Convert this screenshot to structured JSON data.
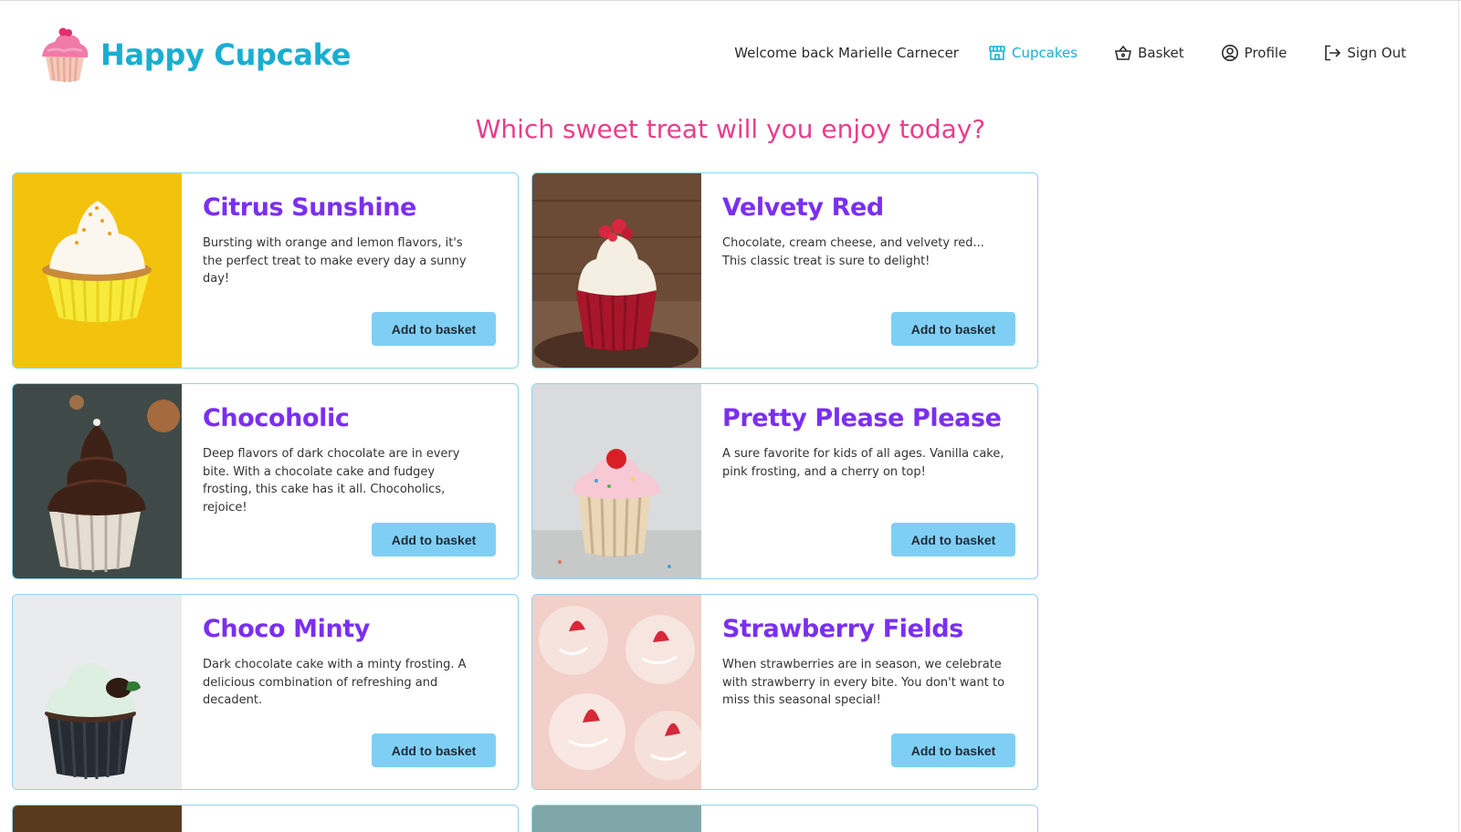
{
  "brand": {
    "name": "Happy Cupcake"
  },
  "nav": {
    "welcome": "Welcome back Marielle Carnecer",
    "items": [
      {
        "label": "Cupcakes",
        "icon": "store-icon",
        "active": true
      },
      {
        "label": "Basket",
        "icon": "basket-icon",
        "active": false
      },
      {
        "label": "Profile",
        "icon": "user-circle-icon",
        "active": false
      },
      {
        "label": "Sign Out",
        "icon": "sign-out-icon",
        "active": false
      }
    ]
  },
  "headline": "Which sweet treat will you enjoy today?",
  "button_label": "Add to basket",
  "cupcakes": [
    {
      "name": "Citrus Sunshine",
      "description": "Bursting with orange and lemon flavors, it's the perfect treat to make every day a sunny day!"
    },
    {
      "name": "Velvety Red",
      "description": "Chocolate, cream cheese, and velvety red... This classic treat is sure to delight!"
    },
    {
      "name": "Chocoholic",
      "description": "Deep flavors of dark chocolate are in every bite. With a chocolate cake and fudgey frosting, this cake has it all. Chocoholics, rejoice!"
    },
    {
      "name": "Pretty Please Please",
      "description": "A sure favorite for kids of all ages. Vanilla cake, pink frosting, and a cherry on top!"
    },
    {
      "name": "Choco Minty",
      "description": "Dark chocolate cake with a minty frosting. A delicious combination of refreshing and decadent."
    },
    {
      "name": "Strawberry Fields",
      "description": "When strawberries are in season, we celebrate with strawberry in every bite. You don't want to miss this seasonal special!"
    }
  ],
  "colors": {
    "brand": "#19aed1",
    "headline": "#e83e8c",
    "title": "#7b2ff0",
    "button": "#7fcff5",
    "card_border": "#8fd3ee"
  }
}
